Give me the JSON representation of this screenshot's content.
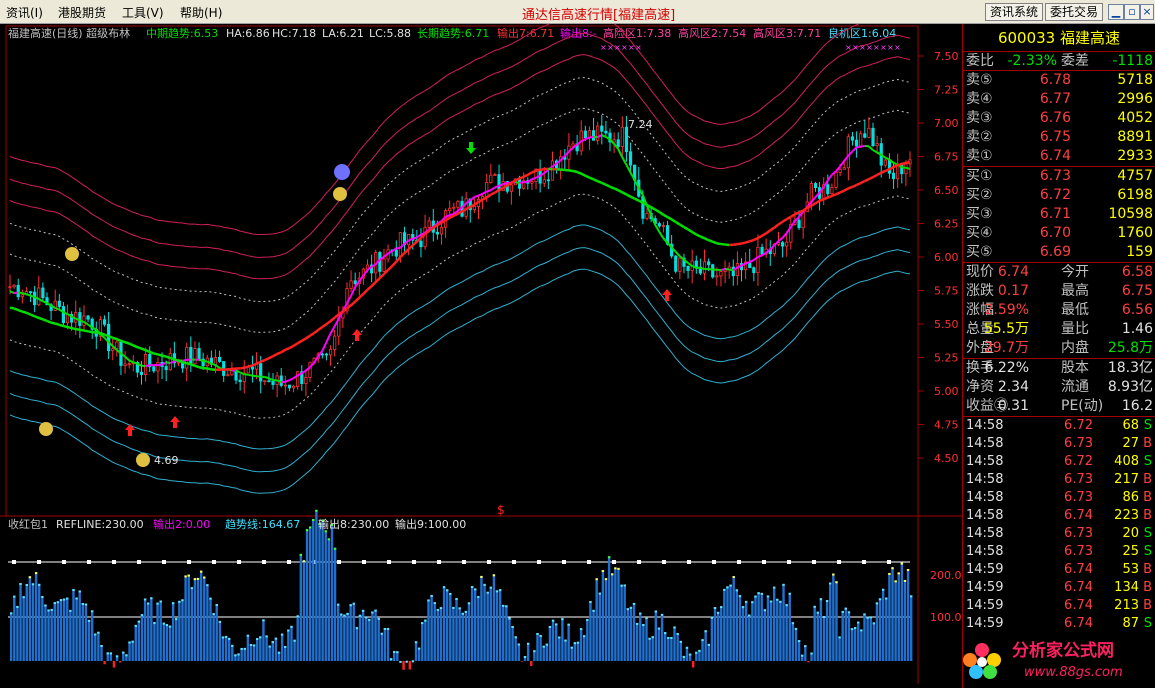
{
  "menu": {
    "items": [
      "资讯(I)",
      "港股期货",
      "工具(V)",
      "帮助(H)"
    ],
    "title": "通达信高速行情",
    "subtitle": "[福建高速]",
    "btn_info": "资讯系统",
    "btn_trade": "委托交易"
  },
  "main_legend": {
    "name": "福建高速(日线) 超级布林",
    "mid": "中期趋势:6.53",
    "ha": "HA:6.86",
    "hc": "HC:7.18",
    "la": "LA:6.21",
    "lc": "LC:5.88",
    "long": "长期趋势:6.71",
    "out7": "输出7:6.71",
    "out8": "输出8:-",
    "high_risk": "高险区1:7.38",
    "high_wind2": "高风区2:7.54",
    "high_wind3": "高风区3:7.71",
    "good_buy": "良机区1:6.04"
  },
  "price_axis": [
    "7.50",
    "7.25",
    "7.00",
    "6.75",
    "6.50",
    "6.25",
    "6.00",
    "5.75",
    "5.50",
    "5.25",
    "5.00",
    "4.75",
    "4.50"
  ],
  "annotations": {
    "high": "7.24",
    "low": "4.69",
    "dollar": "$"
  },
  "sub_legend": {
    "name": "收红包1",
    "refline": "REFLINE:230.00",
    "out2": "输出2:0.00",
    "trend": "趋势线:164.67",
    "out8": "输出8:230.00",
    "out9": "输出9:100.00"
  },
  "sub_axis": [
    "200.0",
    "100.0"
  ],
  "colors": {
    "up": "#ff3030",
    "down": "#00e0e0",
    "mid": "#ff00ff",
    "long_green": "#00e000",
    "long_red": "#ff2020",
    "band_red": "#d0205a",
    "band_cyan": "#30b0d0"
  },
  "panel": {
    "code": "600033",
    "name": "福建高速",
    "weibi_label": "委比",
    "weibi": "-2.33%",
    "weicha_label": "委差",
    "weicha": "-1118",
    "sell": [
      {
        "label": "卖⑤",
        "price": "6.78",
        "qty": "5718"
      },
      {
        "label": "卖④",
        "price": "6.77",
        "qty": "2996"
      },
      {
        "label": "卖③",
        "price": "6.76",
        "qty": "4052"
      },
      {
        "label": "卖②",
        "price": "6.75",
        "qty": "8891"
      },
      {
        "label": "卖①",
        "price": "6.74",
        "qty": "2933"
      }
    ],
    "buy": [
      {
        "label": "买①",
        "price": "6.73",
        "qty": "4757"
      },
      {
        "label": "买②",
        "price": "6.72",
        "qty": "6198"
      },
      {
        "label": "买③",
        "price": "6.71",
        "qty": "10598"
      },
      {
        "label": "买④",
        "price": "6.70",
        "qty": "1760"
      },
      {
        "label": "买⑤",
        "price": "6.69",
        "qty": "159"
      }
    ],
    "stats1": [
      {
        "k": "现价",
        "v": "6.74",
        "vc": "red",
        "k2": "今开",
        "v2": "6.58",
        "v2c": "red"
      },
      {
        "k": "涨跌",
        "v": "0.17",
        "vc": "red",
        "k2": "最高",
        "v2": "6.75",
        "v2c": "red"
      },
      {
        "k": "涨幅",
        "v": "2.59%",
        "vc": "red",
        "k2": "最低",
        "v2": "6.56",
        "v2c": "red"
      },
      {
        "k": "总量",
        "v": "55.5万",
        "vc": "yellow",
        "k2": "量比",
        "v2": "1.46",
        "v2c": "white"
      },
      {
        "k": "外盘",
        "v": "29.7万",
        "vc": "red",
        "k2": "内盘",
        "v2": "25.8万",
        "v2c": "green"
      }
    ],
    "stats2": [
      {
        "k": "换手",
        "v": "6.22%",
        "vc": "white",
        "k2": "股本",
        "v2": "18.3亿",
        "v2c": "white"
      },
      {
        "k": "净资",
        "v": "2.34",
        "vc": "white",
        "k2": "流通",
        "v2": "8.93亿",
        "v2c": "white"
      },
      {
        "k": "收益㊂",
        "v": "0.31",
        "vc": "white",
        "k2": "PE(动)",
        "v2": "16.2",
        "v2c": "white"
      }
    ],
    "ticks": [
      {
        "t": "14:58",
        "p": "6.72",
        "q": "68",
        "f": "S"
      },
      {
        "t": "14:58",
        "p": "6.73",
        "q": "27",
        "f": "B"
      },
      {
        "t": "14:58",
        "p": "6.72",
        "q": "408",
        "f": "S"
      },
      {
        "t": "14:58",
        "p": "6.73",
        "q": "217",
        "f": "B"
      },
      {
        "t": "14:58",
        "p": "6.73",
        "q": "86",
        "f": "B"
      },
      {
        "t": "14:58",
        "p": "6.74",
        "q": "223",
        "f": "B"
      },
      {
        "t": "14:58",
        "p": "6.73",
        "q": "20",
        "f": "S"
      },
      {
        "t": "14:58",
        "p": "6.73",
        "q": "25",
        "f": "S"
      },
      {
        "t": "14:59",
        "p": "6.74",
        "q": "53",
        "f": "B"
      },
      {
        "t": "14:59",
        "p": "6.74",
        "q": "134",
        "f": "B"
      },
      {
        "t": "14:59",
        "p": "6.74",
        "q": "213",
        "f": "B"
      },
      {
        "t": "14:59",
        "p": "6.74",
        "q": "87",
        "f": "S"
      }
    ]
  },
  "watermark": {
    "text": "分析家公式网",
    "url": "www.88gs.com"
  }
}
